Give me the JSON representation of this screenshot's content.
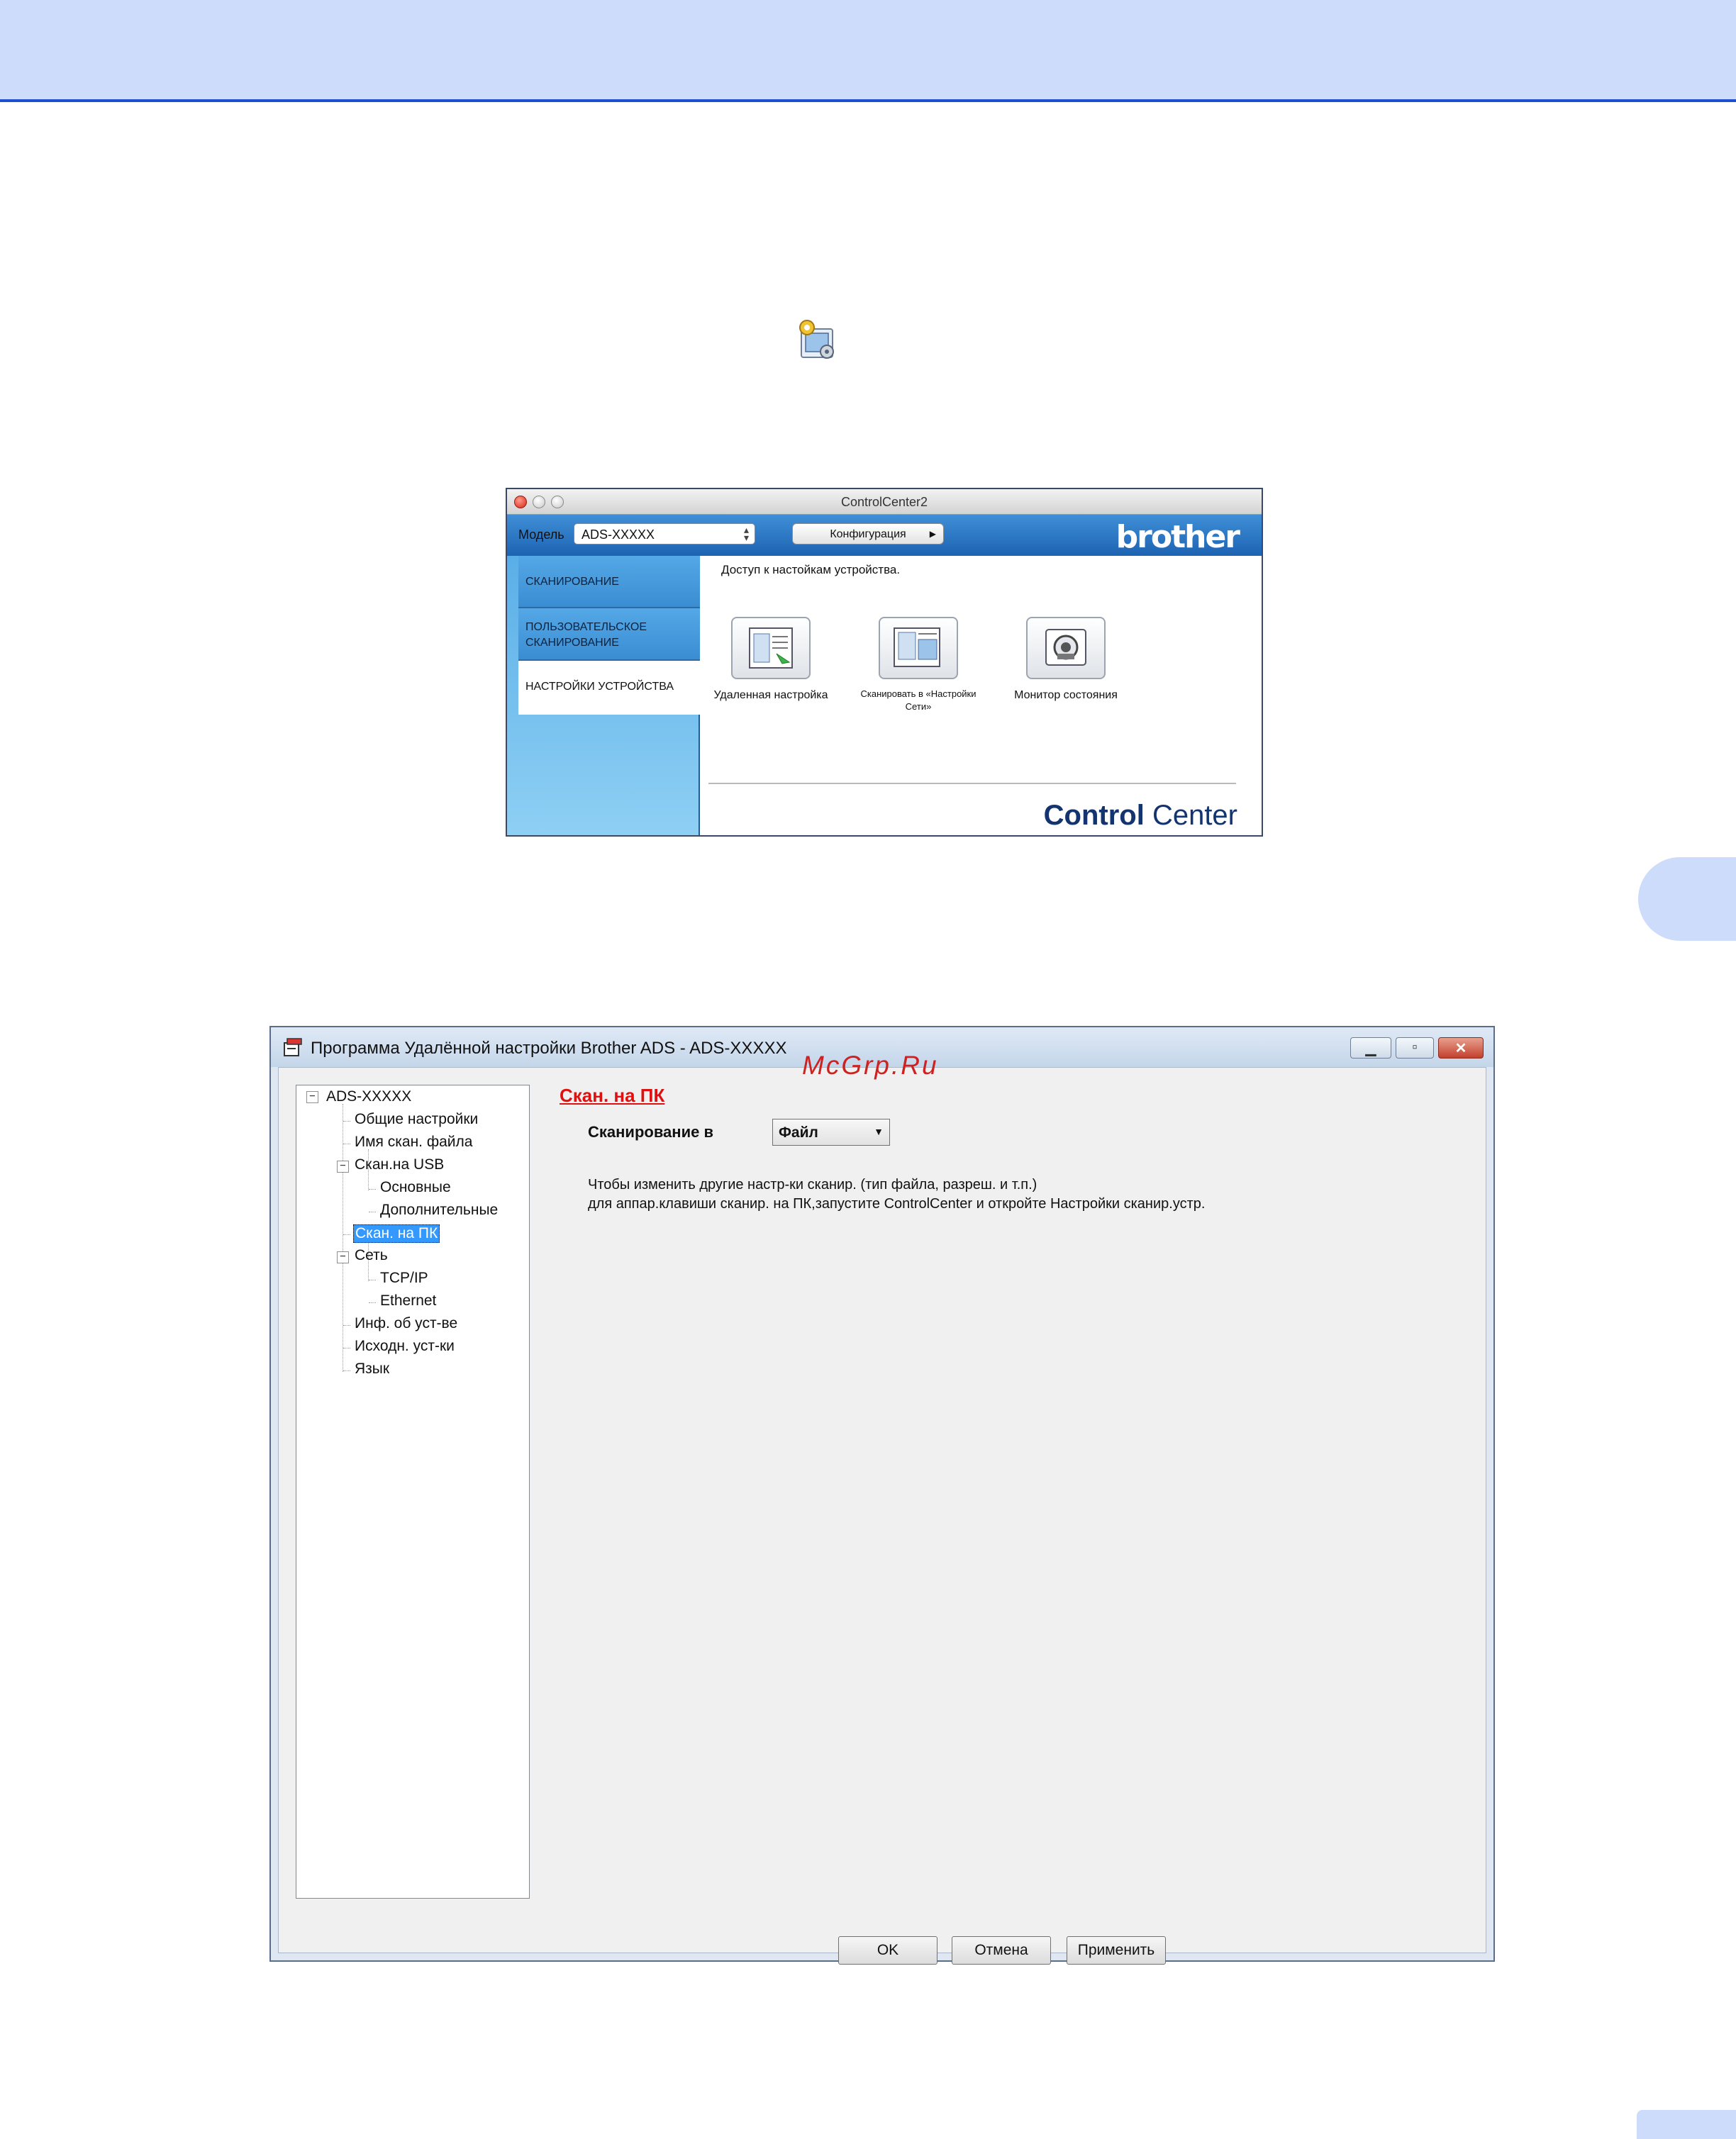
{
  "controlcenter": {
    "title": "ControlCenter2",
    "model_label": "Модель",
    "model_value": "ADS-XXXXX",
    "config_button": "Конфигурация",
    "brand": "brother",
    "tabs": [
      {
        "label": "СКАНИРОВАНИЕ"
      },
      {
        "label": "ПОЛЬЗОВАТЕЛЬСКОЕ СКАНИРОВАНИЕ"
      },
      {
        "label": "НАСТРОЙКИ УСТРОЙСТВА"
      }
    ],
    "description": "Доступ к настойкам устройства.",
    "items": [
      {
        "label": "Удаленная настройка",
        "icon": "remote-setup-icon"
      },
      {
        "label": "Сканировать в «Настройки Сети»",
        "icon": "scan-to-network-icon"
      },
      {
        "label": "Монитор состояния",
        "icon": "status-monitor-icon"
      }
    ],
    "logo_bold": "Control",
    "logo_light": " Center"
  },
  "remote": {
    "title": "Программа Удалённой настройки Brother ADS - ADS-XXXXX",
    "tree": [
      {
        "label": "ADS-XXXXX"
      },
      {
        "label": "Общие настройки"
      },
      {
        "label": "Имя скан. файла"
      },
      {
        "label": "Скан.на USB"
      },
      {
        "label": "Основные"
      },
      {
        "label": "Дополнительные"
      },
      {
        "label": "Скан. на ПК"
      },
      {
        "label": "Сеть"
      },
      {
        "label": "TCP/IP"
      },
      {
        "label": "Ethernet"
      },
      {
        "label": "Инф. об уст-ве"
      },
      {
        "label": "Исходн. уст-ки"
      },
      {
        "label": "Язык"
      }
    ],
    "section_title": "Скан. на ПК",
    "scan_to_label": "Сканирование в",
    "scan_to_value": "Файл",
    "note_line1": "Чтобы изменить другие настр-ки сканир. (тип файла, разреш. и т.п.)",
    "note_line2": "для аппар.клавиши сканир. на ПК,запустите ControlCenter и откройте Настройки сканир.устр.",
    "ok_button": "OK",
    "cancel_button": "Отмена",
    "apply_button": "Применить"
  },
  "watermark": "McGrp.Ru",
  "colors": {
    "band": "#cddcfb",
    "band_border": "#1e4fd0",
    "section_title": "#e01010",
    "selection": "#3399ff"
  }
}
